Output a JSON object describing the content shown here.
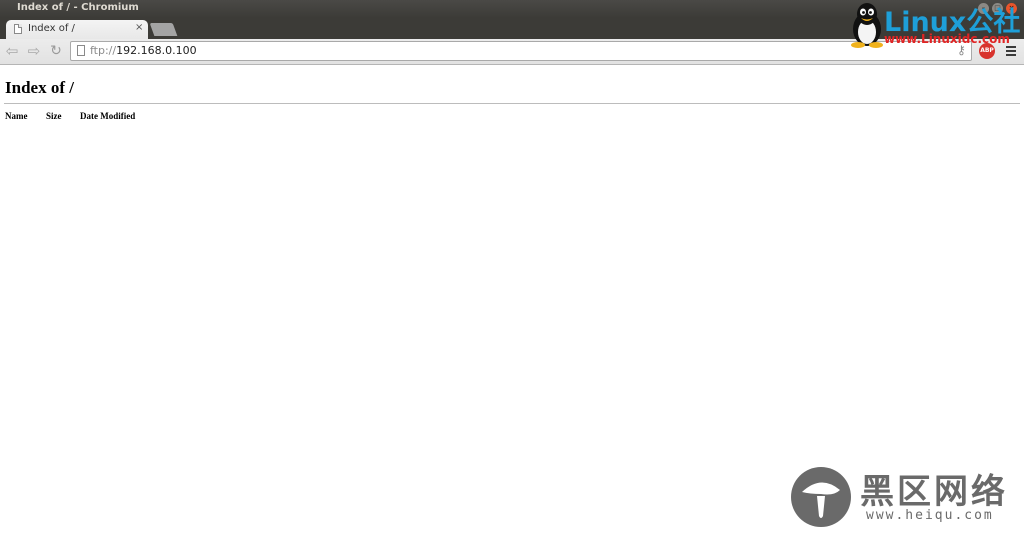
{
  "window": {
    "title": "Index of / - Chromium",
    "controls": [
      "minimize-icon",
      "maximize-icon",
      "close-icon"
    ]
  },
  "tabs": [
    {
      "title": "Index of /",
      "close": "×",
      "active": true
    }
  ],
  "toolbar": {
    "back_icon": "back-arrow-icon",
    "forward_icon": "forward-arrow-icon",
    "reload_icon": "reload-icon",
    "url_scheme": "ftp://",
    "url_host": "192.168.0.100",
    "extensions": {
      "key": "key-icon",
      "adblock_label": "ABP"
    },
    "menu_icon": "hamburger-menu-icon"
  },
  "page": {
    "heading": "Index of /",
    "columns": [
      "Name",
      "Size",
      "Date Modified"
    ],
    "rows": []
  },
  "watermarks": {
    "linux": {
      "wordmark": "Linux公社",
      "site": "www.Linuxidc.com"
    },
    "heiqu": {
      "name_cn": "黑区网络",
      "site": "www.heiqu.com"
    }
  },
  "colors": {
    "titlebar": "#3c3b37",
    "close_button": "#e9552c",
    "abp_red": "#d8332d",
    "linux_blue": "#1e9fd8",
    "linux_red": "#e02424",
    "heiqu_gray": "#6a6a6a"
  }
}
